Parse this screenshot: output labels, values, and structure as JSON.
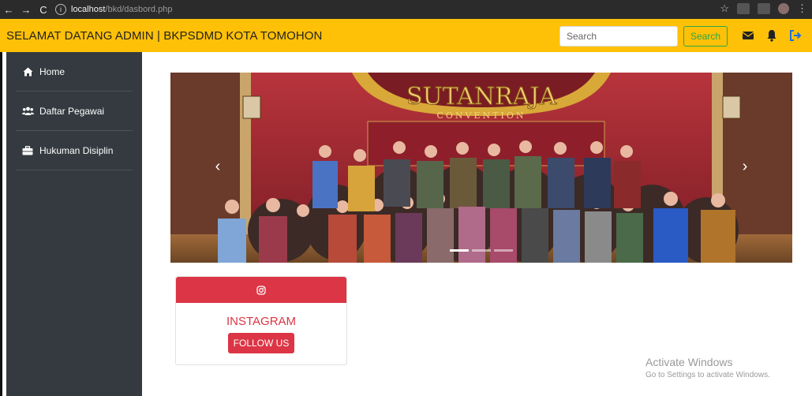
{
  "browser": {
    "url_host": "localhost",
    "url_path": "/bkd/dasbord.php"
  },
  "header": {
    "brand": "SELAMAT DATANG ADMIN | BKPSDMD KOTA TOMOHON",
    "search_placeholder": "Search",
    "search_button": "Search",
    "icons": [
      "envelope-icon",
      "bell-icon",
      "sign-out-icon"
    ]
  },
  "sidebar": {
    "items": [
      {
        "label": "Home",
        "icon": "home-icon"
      },
      {
        "label": "Daftar Pegawai",
        "icon": "users-icon"
      },
      {
        "label": "Hukuman Disiplin",
        "icon": "briefcase-icon"
      }
    ]
  },
  "carousel": {
    "slide_count": 3,
    "active_index": 0,
    "banner_text": "SUTANRAJA",
    "banner_subtext": "CONVENTION"
  },
  "instagram_card": {
    "icon": "instagram-icon",
    "title": "INSTAGRAM",
    "button_label": "FOLLOW US"
  },
  "watermark": {
    "line1": "Activate Windows",
    "line2": "Go to Settings to activate Windows."
  },
  "colors": {
    "navbar": "#ffc107",
    "sidebar": "#343a40",
    "accent_red": "#dc3545",
    "search_green": "#28a745"
  }
}
